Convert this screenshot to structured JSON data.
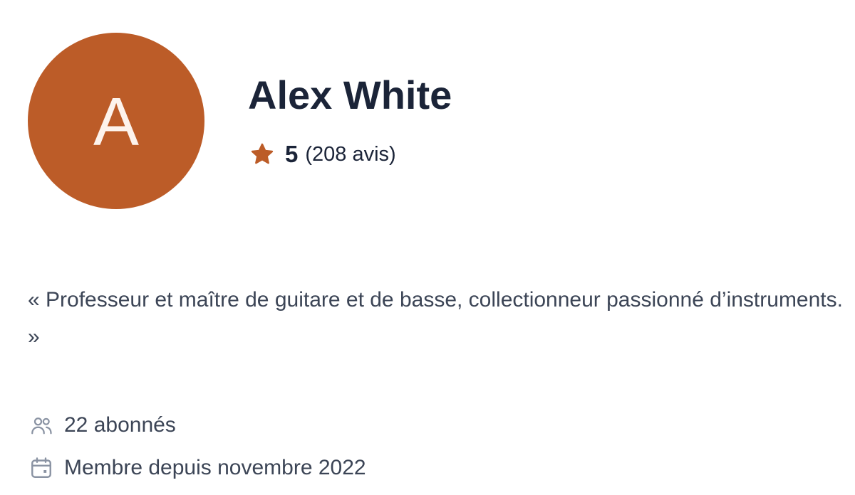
{
  "profile": {
    "avatar_initial": "A",
    "name": "Alex White",
    "rating": {
      "value": "5",
      "count_label": "(208 avis)",
      "icon": "star-icon"
    },
    "bio": "« Professeur et maître de guitare et de basse, collectionneur passionné d’instruments. »",
    "followers": {
      "label": "22 abonnés",
      "icon": "users-icon"
    },
    "member_since": {
      "label": "Membre depuis novembre 2022",
      "icon": "calendar-icon"
    }
  },
  "colors": {
    "avatar_bg": "#bc5c28",
    "accent": "#bc5c28",
    "heading": "#1b2438",
    "body_text": "#3c4556",
    "icon_gray": "#8a93a3"
  }
}
